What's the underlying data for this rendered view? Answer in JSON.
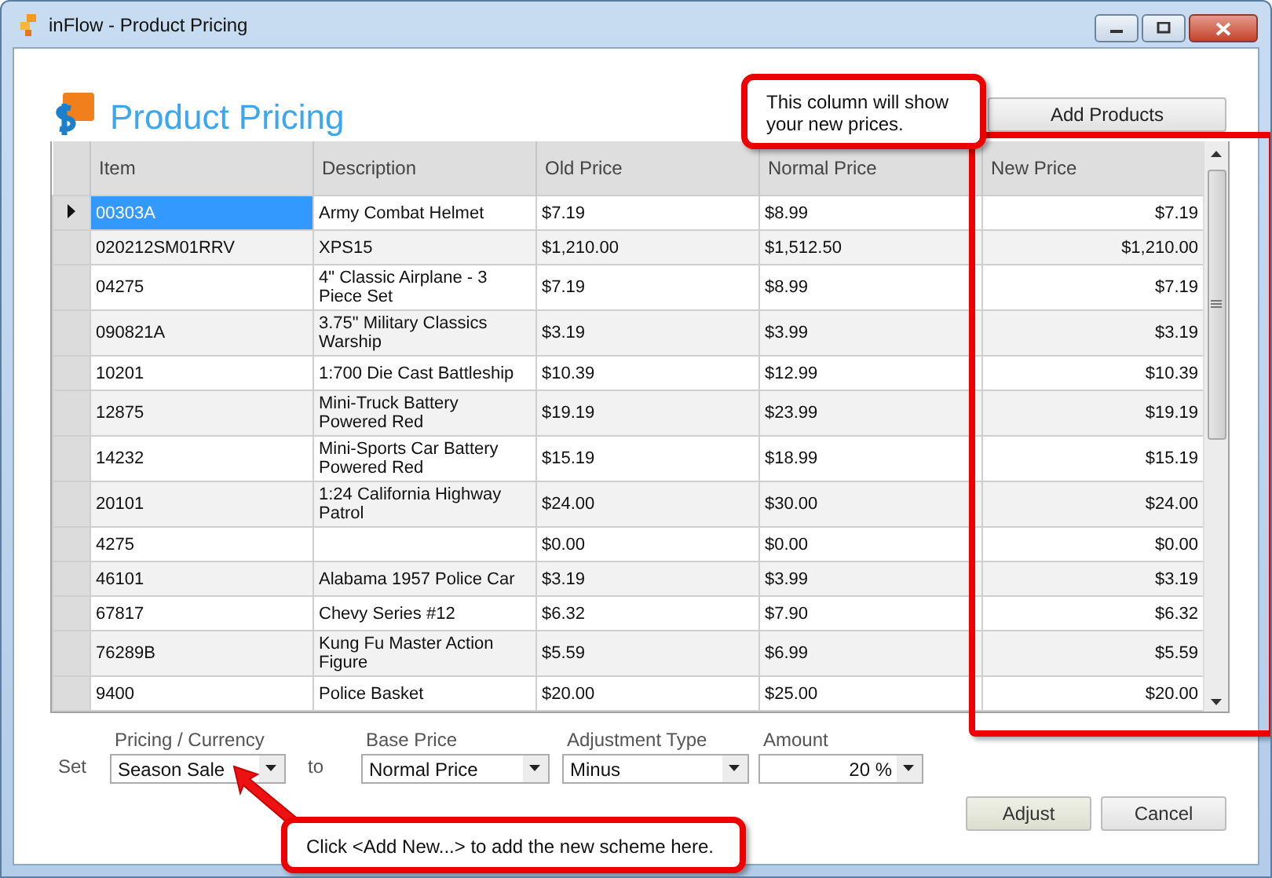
{
  "window": {
    "title": "inFlow - Product Pricing"
  },
  "header": {
    "title": "Product Pricing",
    "add_button": "Add Products"
  },
  "table": {
    "columns": [
      "Item",
      "Description",
      "Old Price",
      "Normal Price",
      "New Price"
    ],
    "rows": [
      {
        "item": "00303A",
        "description": "Army Combat Helmet",
        "old_price": "$7.19",
        "normal_price": "$8.99",
        "new_price": "$7.19",
        "selected": true
      },
      {
        "item": "020212SM01RRV",
        "description": "XPS15",
        "old_price": "$1,210.00",
        "normal_price": "$1,512.50",
        "new_price": "$1,210.00",
        "selected": false
      },
      {
        "item": "04275",
        "description": "4\" Classic Airplane - 3 Piece Set",
        "old_price": "$7.19",
        "normal_price": "$8.99",
        "new_price": "$7.19",
        "selected": false
      },
      {
        "item": "090821A",
        "description": "3.75\" Military Classics Warship",
        "old_price": "$3.19",
        "normal_price": "$3.99",
        "new_price": "$3.19",
        "selected": false
      },
      {
        "item": "10201",
        "description": "1:700 Die Cast Battleship",
        "old_price": "$10.39",
        "normal_price": "$12.99",
        "new_price": "$10.39",
        "selected": false
      },
      {
        "item": "12875",
        "description": "Mini-Truck Battery Powered Red",
        "old_price": "$19.19",
        "normal_price": "$23.99",
        "new_price": "$19.19",
        "selected": false
      },
      {
        "item": "14232",
        "description": "Mini-Sports Car Battery Powered Red",
        "old_price": "$15.19",
        "normal_price": "$18.99",
        "new_price": "$15.19",
        "selected": false
      },
      {
        "item": "20101",
        "description": "1:24 California Highway Patrol",
        "old_price": "$24.00",
        "normal_price": "$30.00",
        "new_price": "$24.00",
        "selected": false
      },
      {
        "item": "4275",
        "description": "",
        "old_price": "$0.00",
        "normal_price": "$0.00",
        "new_price": "$0.00",
        "selected": false
      },
      {
        "item": "46101",
        "description": "Alabama 1957 Police Car",
        "old_price": "$3.19",
        "normal_price": "$3.99",
        "new_price": "$3.19",
        "selected": false
      },
      {
        "item": "67817",
        "description": "Chevy Series #12",
        "old_price": "$6.32",
        "normal_price": "$7.90",
        "new_price": "$6.32",
        "selected": false
      },
      {
        "item": "76289B",
        "description": "Kung Fu Master Action Figure",
        "old_price": "$5.59",
        "normal_price": "$6.99",
        "new_price": "$5.59",
        "selected": false
      },
      {
        "item": "9400",
        "description": "Police Basket",
        "old_price": "$20.00",
        "normal_price": "$25.00",
        "new_price": "$20.00",
        "selected": false
      }
    ]
  },
  "form": {
    "set_label": "Set",
    "pricing_field": {
      "label": "Pricing / Currency",
      "value": "Season Sale"
    },
    "to_label": "to",
    "target_fields": [
      {
        "label": "Base Price",
        "value": "Normal Price",
        "kind": "dropdown"
      },
      {
        "label": "Adjustment Type",
        "value": "Minus",
        "kind": "dropdown"
      },
      {
        "label": "Amount",
        "value": "20 %",
        "kind": "amount"
      }
    ]
  },
  "buttons": [
    "Adjust",
    "Cancel"
  ],
  "callouts": [
    {
      "text": "This column will show your new prices.",
      "kind": "column"
    },
    {
      "text": "Click <Add New...> to add the new scheme here.",
      "kind": "field"
    }
  ]
}
